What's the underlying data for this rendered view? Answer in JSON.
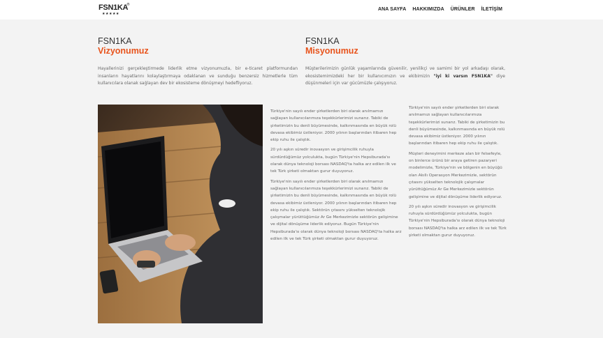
{
  "header": {
    "logo": {
      "text": "FSN1KA",
      "reg": "®",
      "stars": "★★★★★"
    },
    "nav": [
      {
        "label": "ANA SAYFA"
      },
      {
        "label": "HAKKIMIZDA"
      },
      {
        "label": "ÜRÜNLER"
      },
      {
        "label": "İLETİŞİM"
      }
    ]
  },
  "vision": {
    "brand": "FSN1KA",
    "title": "Vizyonumuz",
    "text": "Hayallerinizi gerçekleştirmede liderlik etme vizyonumuzla, bir e-ticaret platformundan insanların hayatlarını kolaylaştırmaya odaklanan ve sunduğu benzersiz hizmetlerle tüm kullanıcılara olanak sağlayan dev bir ekosisteme dönüşmeyi hedefliyoruz."
  },
  "mission": {
    "brand": "FSN1KA",
    "title": "Misyonumuz",
    "text_before": "Müşterilerimizin günlük yaşamlarında güvenilir, yenilikçi ve samimi bir yol arkadaşı olarak, ekosistemimizdeki her bir kullanıcımızın ve ekibimizin ",
    "text_bold": "\"iyi ki varsın FSN1KA\"",
    "text_after": " diye düşünmeleri için var gücümüzle çalışıyoruz."
  },
  "about_middle": [
    "Türkiye'nin sayılı ender şirketlerden biri olarak anılmamızı sağlayan kullanıcılarımıza teşekkürlerimizi sunarız. Tabiki de şirketimizin bu denli büyümesinde, kalkınmasında en büyük rolü devasa ekibimiz üstleniyor. 2000 yılının başlarından itibaren hep ekip ruhu ile çalıştık.",
    "20 yılı aşkın süredir inovasyon ve girişimcilik ruhuyla sürdürdüğümüz yolculukta, bugün Türkiye'nin Hepsiburada'sı olarak dünya teknoloji borsası NASDAQ'ta halka arz edilen ilk ve tek Türk şirketi olmaktan gurur duyuyoruz.",
    "Türkiye'nin sayılı ender şirketlerden biri olarak anılmamızı sağlayan kullanıcılarımıza teşekkürlerimizi sunarız. Tabiki de şirketimizin bu denli büyümesinde, kalkınmasında en büyük rolü devasa ekibimiz üstleniyor. 2000 yılının başlarından itibaren hep ekip ruhu ile çalıştık. Sektörün çıtasını yükselten teknolojik çalışmalar yürüttüğümüz Ar Ge Merkezimizle sektörün gelişimine ve dijital dönüşüme liderlik ediyoruz. Bugün Türkiye'nin Hepsiburada'sı olarak dünya teknoloji borsası NASDAQ'ta halka arz edilen ilk ve tek Türk şirketi olmaktan gurur duyuyoruz."
  ],
  "about_right": [
    "Türkiye'nin sayılı ender şirketlerden biri olarak anılmamızı sağlayan kullanıcılarımıza teşekkürlerimizi sunarız. Tabiki de şirketimizin bu denli büyümesinde, kalkınmasında en büyük rolü devasa ekibimiz üstleniyor. 2000 yılının başlarından itibaren hep ekip ruhu ile çalıştık.",
    "Müşteri deneyimini merkeze alan bir felsefeyle, on binlerce ürünü bir araya getiren pazaryeri modelimizle, Türkiye'nin ve bölgenin en büyüğü olan Akıllı Operasyon Merkezimizle, sektörün çıtasını yükselten teknolojik çalışmalar yürüttüğümüz Ar Ge Merkezimizle sektörün gelişimine ve dijital dönüşüme liderlik ediyoruz.",
    "20 yılı aşkın süredir inovasyon ve girişimcilik ruhuyla sürdürdüğümüz yolculukta, bugün Türkiye'nin Hepsiburada'sı olarak dünya teknoloji borsası NASDAQ'ta halka arz edilen ilk ve tek Türk şirketi olmaktan gurur duyuyoruz."
  ],
  "colors": {
    "accent": "#e8531b",
    "background": "#f3f3f3",
    "header": "#ffffff"
  },
  "photo": {
    "icon": "laptop-photo"
  }
}
